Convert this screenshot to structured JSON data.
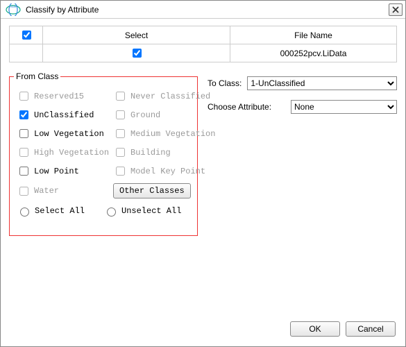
{
  "dialog": {
    "title": "Classify by Attribute"
  },
  "table": {
    "headers": {
      "select": "Select",
      "filename": "File Name"
    },
    "rows": [
      {
        "selected": true,
        "filename": "000252pcv.LiData"
      }
    ]
  },
  "from_class": {
    "legend": "From Class",
    "items": [
      {
        "label": "Reserved15",
        "checked": false,
        "disabled": true
      },
      {
        "label": "Never Classified",
        "checked": false,
        "disabled": true
      },
      {
        "label": "UnClassified",
        "checked": true,
        "disabled": false
      },
      {
        "label": "Ground",
        "checked": false,
        "disabled": true
      },
      {
        "label": "Low Vegetation",
        "checked": false,
        "disabled": false
      },
      {
        "label": "Medium Vegetation",
        "checked": false,
        "disabled": true
      },
      {
        "label": "High Vegetation",
        "checked": false,
        "disabled": true
      },
      {
        "label": "Building",
        "checked": false,
        "disabled": true
      },
      {
        "label": "Low Point",
        "checked": false,
        "disabled": false
      },
      {
        "label": "Model Key Point",
        "checked": false,
        "disabled": true
      },
      {
        "label": "Water",
        "checked": false,
        "disabled": true
      }
    ],
    "other_button": "Other Classes",
    "select_all": "Select All",
    "unselect_all": "Unselect All"
  },
  "right": {
    "to_class_label": "To Class:",
    "to_class_value": "1-UnClassified",
    "to_class_options": [
      "1-UnClassified"
    ],
    "attr_label": "Choose Attribute:",
    "attr_value": "None",
    "attr_options": [
      "None"
    ]
  },
  "footer": {
    "ok": "OK",
    "cancel": "Cancel"
  }
}
